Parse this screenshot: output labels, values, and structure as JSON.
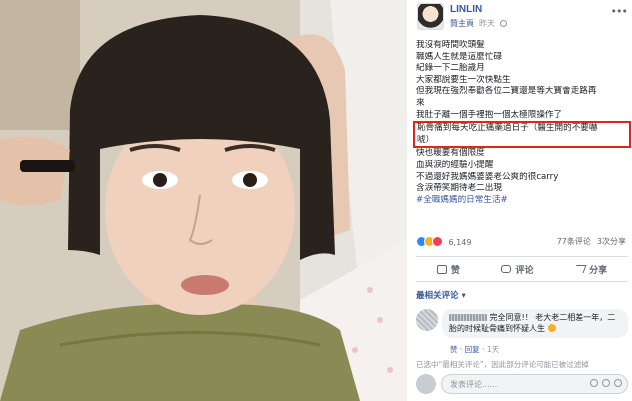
{
  "post": {
    "author": "LINLIN",
    "sponsor": "贊主頁",
    "time": "昨天",
    "lines": [
      "我沒有時間吹頭髮",
      "職媽人生就是這麼忙碌",
      "紀錄一下二胎歲月",
      "大家都說要生一次快點生",
      "但我現在強烈奉勸各位二寶還是等大寶會走路再",
      "來",
      "我肚子離一個手裡抱一個太極限操作了"
    ],
    "highlight_lines": [
      "恥骨痛到每天吃止痛藥過日子（醫生開的不要嚇",
      "唬）"
    ],
    "after_lines": [
      "快也暖要有個限度",
      "血與淚的經驗小提醒",
      "不過還好我媽媽婆婆老公爽的很carry",
      "含淚帶笑期待老二出現"
    ],
    "hashtag": "#全職媽媽的日常生活#"
  },
  "reactions": {
    "count": "6,149",
    "comments": "77条评论",
    "shares": "3次分享"
  },
  "actions": {
    "like": "赞",
    "comment": "评论",
    "share": "分享"
  },
  "comments_section": {
    "sort_label": "最相关评论",
    "first_comment": {
      "text": "完全同意!！ 老大老二相差一年，二胎的时候耻骨痛到怀疑人生",
      "like": "赞",
      "reply": "回复",
      "time": "1天"
    },
    "reply_summary": "已选中“最相关评论”，因此部分评论可能已被过滤掉",
    "input_placeholder": "发表评论......"
  },
  "colors": {
    "link": "#385898",
    "highlight_border": "#e0261a",
    "like_blue": "#2d88ff"
  }
}
